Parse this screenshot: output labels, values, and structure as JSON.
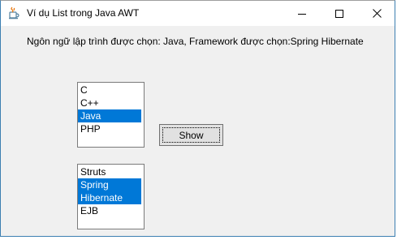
{
  "window": {
    "title": "Ví dụ List trong Java AWT",
    "icon": "java-cup-icon",
    "controls": {
      "minimize": "minimize-icon",
      "maximize": "maximize-icon",
      "close": "close-icon"
    }
  },
  "info_label": "Ngôn ngữ lập trình được chọn: Java, Framework được chọn:Spring Hibernate",
  "language_list": {
    "items": [
      {
        "label": "C",
        "selected": false
      },
      {
        "label": "C++",
        "selected": false
      },
      {
        "label": "Java",
        "selected": true
      },
      {
        "label": "PHP",
        "selected": false
      }
    ]
  },
  "framework_list": {
    "items": [
      {
        "label": "Struts",
        "selected": false
      },
      {
        "label": "Spring",
        "selected": true
      },
      {
        "label": "Hibernate",
        "selected": true
      },
      {
        "label": "EJB",
        "selected": false
      }
    ]
  },
  "show_button": {
    "label": "Show"
  },
  "colors": {
    "selection": "#0078d7",
    "window_bg": "#f0f0f0"
  }
}
